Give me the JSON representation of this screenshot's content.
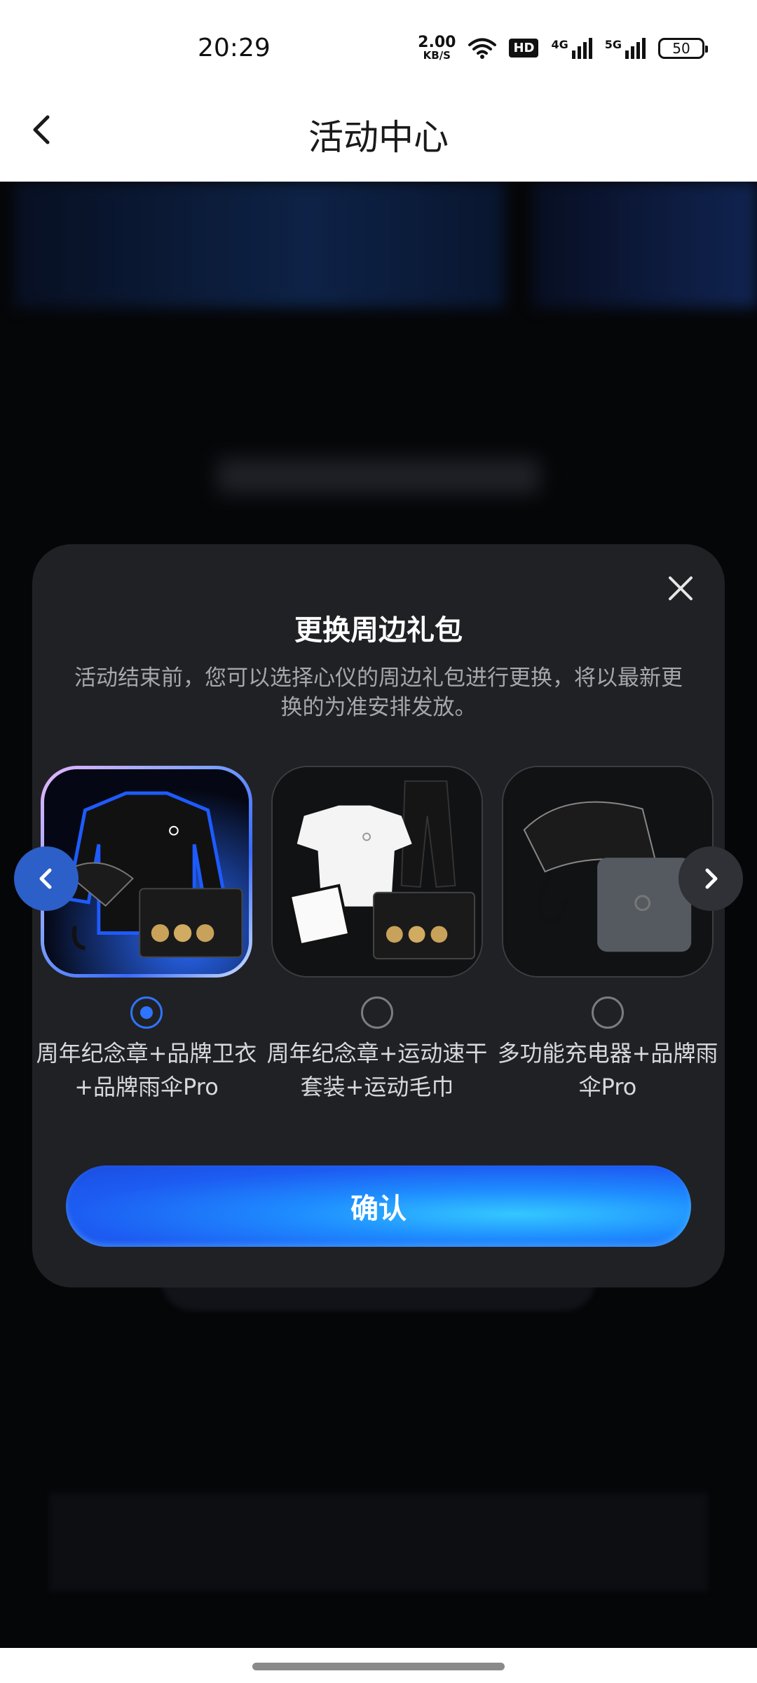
{
  "status_bar": {
    "time": "20:29",
    "net_speed_value": "2.00",
    "net_speed_unit": "KB/S",
    "hd_badge": "HD",
    "signal_1_label": "4G",
    "signal_2_label": "5G",
    "battery_level": "50"
  },
  "header": {
    "title": "活动中心"
  },
  "modal": {
    "title": "更换周边礼包",
    "description": "活动结束前，您可以选择心仪的周边礼包进行更换，将以最新更换的为准安排发放。",
    "options": [
      {
        "label": "周年纪念章+品牌卫衣+品牌雨伞Pro",
        "selected": true
      },
      {
        "label": "周年纪念章+运动速干套装+运动毛巾",
        "selected": false
      },
      {
        "label": "多功能充电器+品牌雨伞Pro",
        "selected": false
      }
    ],
    "confirm_label": "确认"
  },
  "colors": {
    "accent": "#2f74ff",
    "modal_bg": "#202124",
    "button_gradient_start": "#1b4de0",
    "button_gradient_end": "#34c7ff"
  },
  "icons": [
    "back-arrow-icon",
    "close-icon",
    "chevron-left-icon",
    "chevron-right-icon",
    "wifi-icon",
    "signal-icon",
    "battery-icon"
  ]
}
